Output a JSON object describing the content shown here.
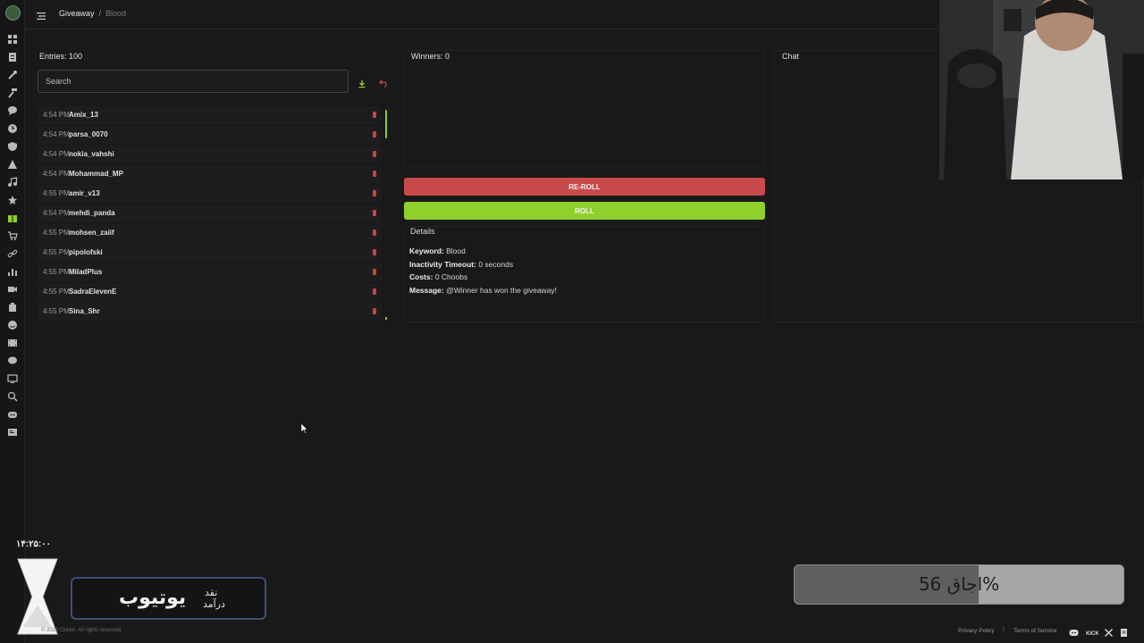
{
  "breadcrumb": {
    "parent": "Giveaway",
    "separator": "/",
    "current": "Blood"
  },
  "entries_panel": {
    "title": "Entries: 100",
    "search_placeholder": "Search",
    "entries": [
      {
        "time": "4:54 PM",
        "name": "Amix_13"
      },
      {
        "time": "4:54 PM",
        "name": "parsa_0070"
      },
      {
        "time": "4:54 PM",
        "name": "nokia_vahshi"
      },
      {
        "time": "4:54 PM",
        "name": "Mohammad_MP"
      },
      {
        "time": "4:55 PM",
        "name": "amir_v13"
      },
      {
        "time": "4:54 PM",
        "name": "mehdi_panda"
      },
      {
        "time": "4:55 PM",
        "name": "mohsen_zaiif"
      },
      {
        "time": "4:55 PM",
        "name": "pipolofski"
      },
      {
        "time": "4:55 PM",
        "name": "MiladPlus"
      },
      {
        "time": "4:55 PM",
        "name": "SadraElevenE"
      },
      {
        "time": "4:55 PM",
        "name": "Sina_Shr"
      }
    ]
  },
  "winners_panel": {
    "title": "Winners: 0"
  },
  "buttons": {
    "reroll": "RE-ROLL",
    "roll": "ROLL"
  },
  "details": {
    "title": "Details",
    "keyword_label": "Keyword:",
    "keyword": "Blood",
    "timeout_label": "Inactivity Timeout:",
    "timeout": "0 seconds",
    "costs_label": "Costs:",
    "costs": "0 Choobs",
    "message_label": "Message:",
    "message": "@Winner has won the giveaway!"
  },
  "chat_panel": {
    "title": "Chat"
  },
  "overlay": {
    "timer": "۱۴:۲۵:۰۰",
    "youtube_main": "یوتیوب",
    "youtube_small1": "نقد",
    "youtube_small2": "درآمد",
    "progress_label": "اجاق 56%",
    "progress_percent": 56
  },
  "footer": {
    "copyright": "© 2025 Ocklet. All rights reserved.",
    "privacy": "Privacy Policy",
    "separator": "|",
    "terms": "Terms of Service"
  },
  "colors": {
    "accent_green": "#8fd02a",
    "accent_red": "#c94a4b",
    "background": "#191919"
  },
  "sidebar_icons": [
    "dashboard-icon",
    "document-icon",
    "wrench-icon",
    "hammer-icon",
    "chat-bubble-icon",
    "clock-icon",
    "shield-icon",
    "warning-icon",
    "music-icon",
    "star-icon",
    "gift-icon",
    "cart-icon",
    "link-icon",
    "bar-chart-icon",
    "video-icon",
    "package-icon",
    "emoji-icon",
    "film-icon",
    "comment-icon",
    "monitor-icon",
    "search-icon",
    "discord-icon",
    "id-card-icon"
  ]
}
